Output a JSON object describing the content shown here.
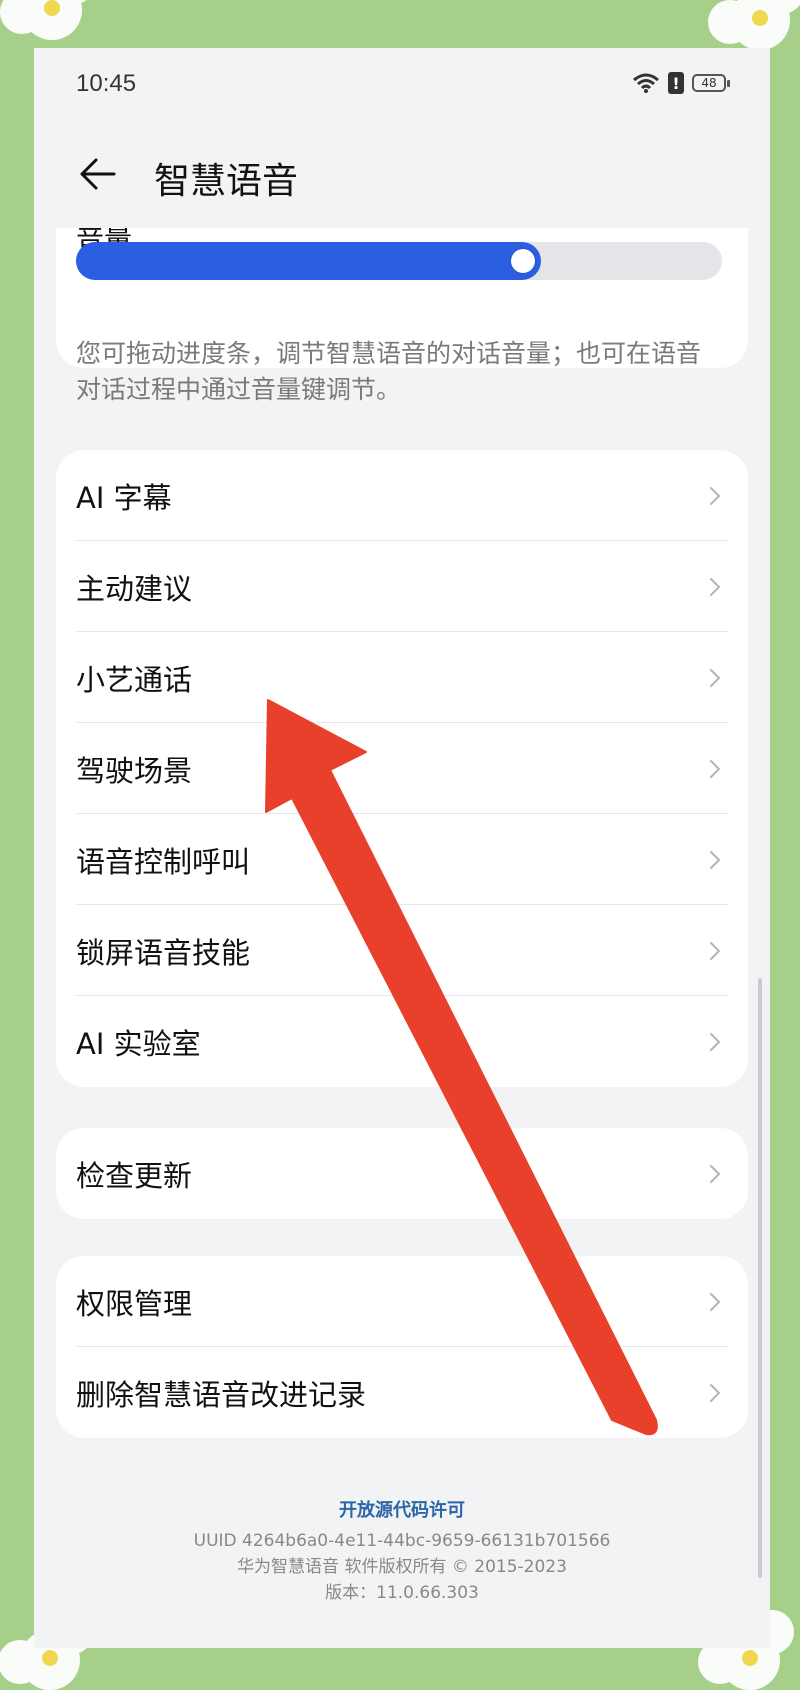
{
  "status": {
    "time": "10:45",
    "battery": "48"
  },
  "header": {
    "title": "智慧语音"
  },
  "volume": {
    "label": "音量",
    "level": 0.72,
    "hint": "您可拖动进度条，调节智慧语音的对话音量；也可在语音对话过程中通过音量键调节。"
  },
  "settings_group_1": [
    {
      "label": "AI 字幕"
    },
    {
      "label": "主动建议"
    },
    {
      "label": "小艺通话"
    },
    {
      "label": "驾驶场景"
    },
    {
      "label": "语音控制呼叫"
    },
    {
      "label": "锁屏语音技能"
    },
    {
      "label": "AI 实验室"
    }
  ],
  "settings_group_2": [
    {
      "label": "检查更新"
    }
  ],
  "settings_group_3": [
    {
      "label": "权限管理"
    },
    {
      "label": "删除智慧语音改进记录"
    }
  ],
  "footer": {
    "license_link": "开放源代码许可",
    "uuid": "UUID 4264b6a0-4e11-44bc-9659-66131b701566",
    "copyright": "华为智慧语音 软件版权所有 © 2015-2023",
    "version": "版本：11.0.66.303"
  },
  "colors": {
    "accent": "#2c5ee4",
    "frame": "#a6d08a",
    "annotation_arrow": "#e8402b"
  },
  "icons": [
    "wifi-icon",
    "alert-icon",
    "battery-icon",
    "back-arrow-icon",
    "chevron-right-icon"
  ]
}
